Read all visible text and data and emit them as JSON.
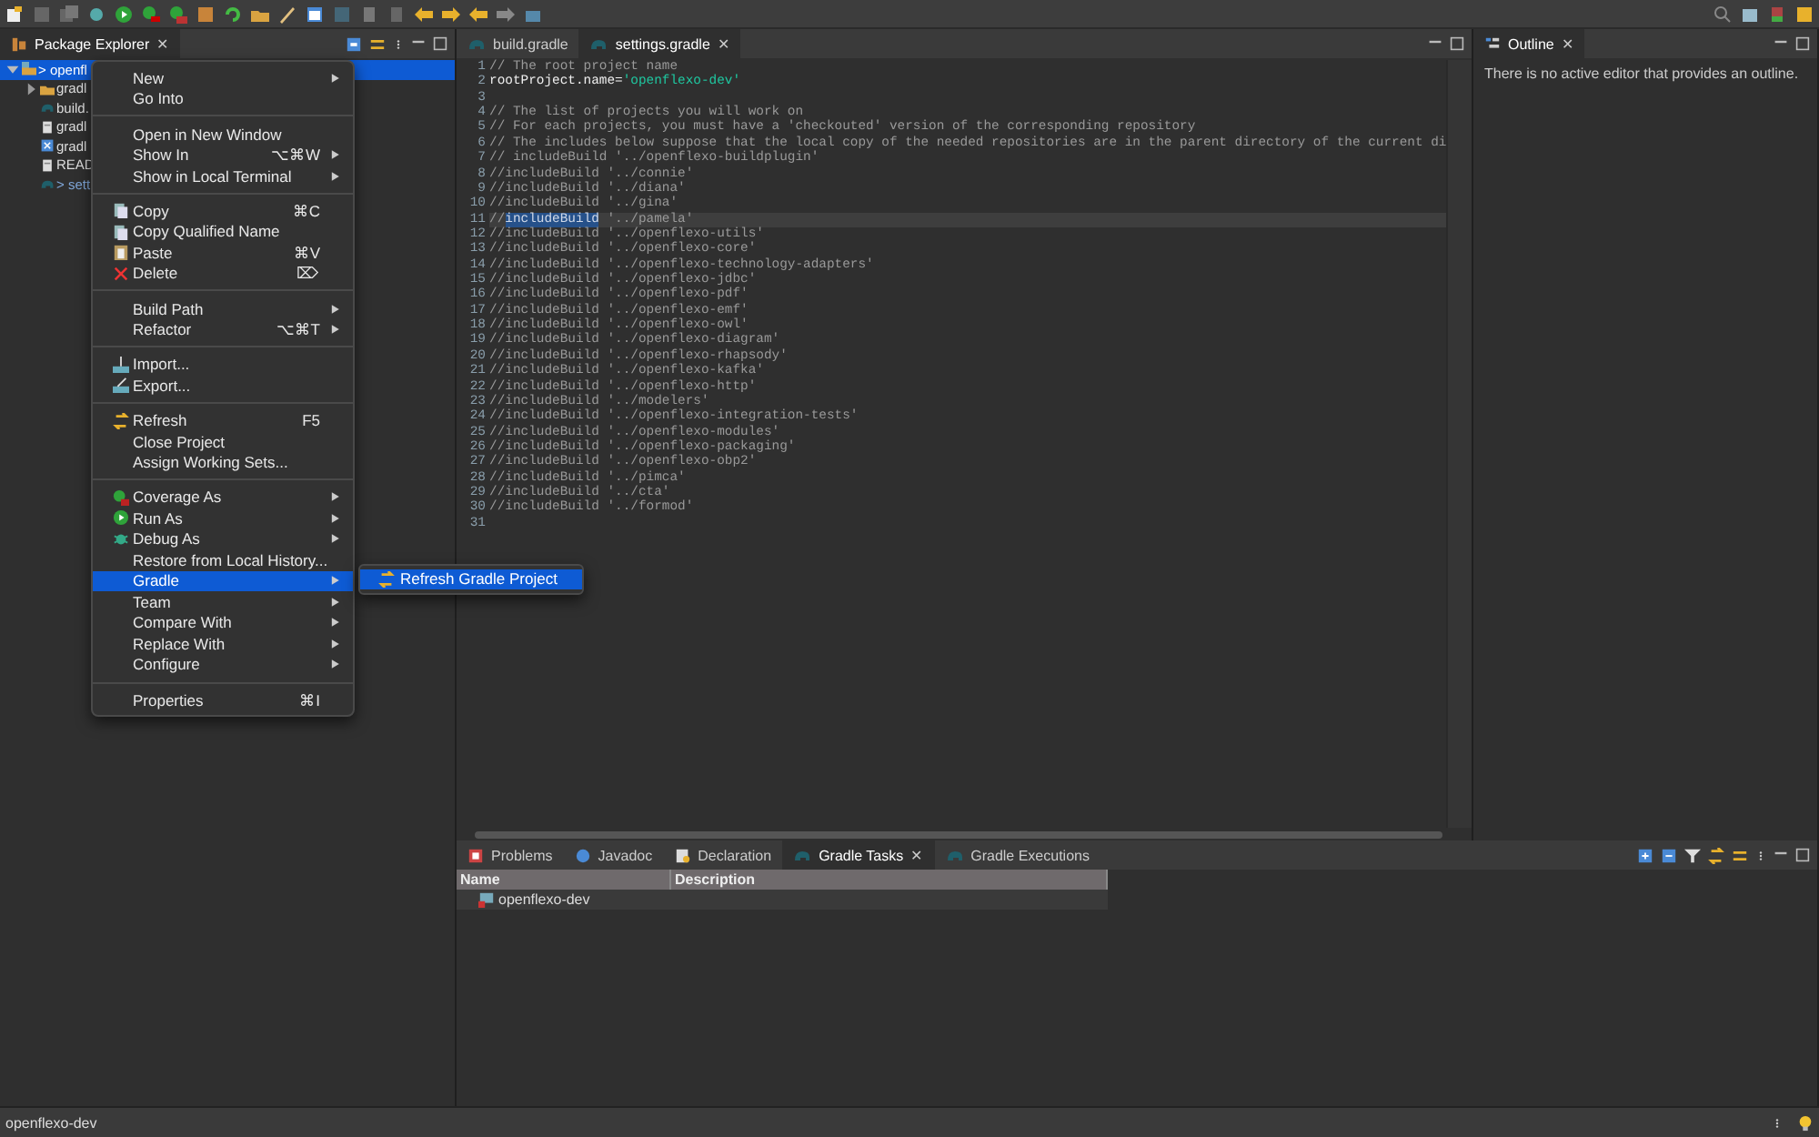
{
  "package_explorer": {
    "tab": {
      "label": "Package Explorer",
      "selected": true,
      "close": "✕"
    },
    "tree": [
      {
        "label": "> openfl",
        "kind": "project",
        "selected": true,
        "expanded": true,
        "modified": false,
        "children": [
          {
            "label": "gradl",
            "kind": "folder",
            "selected": false,
            "expanded": false,
            "modified": false
          },
          {
            "label": "build.",
            "kind": "gradle",
            "selected": false,
            "modified": false
          },
          {
            "label": "gradl",
            "kind": "file",
            "selected": false,
            "modified": false
          },
          {
            "label": "gradl",
            "kind": "script",
            "selected": false,
            "modified": false
          },
          {
            "label": "READ",
            "kind": "file",
            "selected": false,
            "modified": false
          },
          {
            "label": "> sett",
            "kind": "gradle",
            "selected": false,
            "modified": true
          }
        ]
      }
    ]
  },
  "context_menu": {
    "items": [
      {
        "kind": "item",
        "label": "New",
        "submenu": true,
        "selected": false,
        "icon": false
      },
      {
        "kind": "item",
        "label": "Go Into",
        "submenu": false,
        "selected": false,
        "icon": false
      },
      {
        "kind": "separator"
      },
      {
        "kind": "item",
        "label": "Open in New Window",
        "submenu": false,
        "selected": false,
        "icon": false
      },
      {
        "kind": "item",
        "label": "Show In",
        "shortcut": "⌥⌘W",
        "submenu": true,
        "selected": false,
        "icon": false
      },
      {
        "kind": "item",
        "label": "Show in Local Terminal",
        "submenu": true,
        "selected": false,
        "icon": false
      },
      {
        "kind": "separator"
      },
      {
        "kind": "item",
        "label": "Copy",
        "shortcut": "⌘C",
        "submenu": false,
        "selected": false,
        "icon": true
      },
      {
        "kind": "item",
        "label": "Copy Qualified Name",
        "submenu": false,
        "selected": false,
        "icon": true
      },
      {
        "kind": "item",
        "label": "Paste",
        "shortcut": "⌘V",
        "submenu": false,
        "selected": false,
        "icon": true
      },
      {
        "kind": "item",
        "label": "Delete",
        "shortcut": "⌦",
        "submenu": false,
        "selected": false,
        "icon": true
      },
      {
        "kind": "separator"
      },
      {
        "kind": "item",
        "label": "Build Path",
        "submenu": true,
        "selected": false,
        "icon": false
      },
      {
        "kind": "item",
        "label": "Refactor",
        "shortcut": "⌥⌘T",
        "submenu": true,
        "selected": false,
        "icon": false
      },
      {
        "kind": "separator"
      },
      {
        "kind": "item",
        "label": "Import...",
        "submenu": false,
        "selected": false,
        "icon": true
      },
      {
        "kind": "item",
        "label": "Export...",
        "submenu": false,
        "selected": false,
        "icon": true
      },
      {
        "kind": "separator"
      },
      {
        "kind": "item",
        "label": "Refresh",
        "shortcut": "F5",
        "submenu": false,
        "selected": false,
        "icon": true
      },
      {
        "kind": "item",
        "label": "Close Project",
        "submenu": false,
        "selected": false,
        "icon": false
      },
      {
        "kind": "item",
        "label": "Assign Working Sets...",
        "submenu": false,
        "selected": false,
        "icon": false
      },
      {
        "kind": "separator"
      },
      {
        "kind": "item",
        "label": "Coverage As",
        "submenu": true,
        "selected": false,
        "icon": true
      },
      {
        "kind": "item",
        "label": "Run As",
        "submenu": true,
        "selected": false,
        "icon": true
      },
      {
        "kind": "item",
        "label": "Debug As",
        "submenu": true,
        "selected": false,
        "icon": true
      },
      {
        "kind": "item",
        "label": "Restore from Local History...",
        "submenu": false,
        "selected": false,
        "icon": false
      },
      {
        "kind": "item",
        "label": "Gradle",
        "submenu": true,
        "selected": true,
        "icon": false,
        "open_submenu": {
          "items": [
            {
              "label": "Refresh Gradle Project",
              "selected": true,
              "icon": true
            }
          ]
        }
      },
      {
        "kind": "item",
        "label": "Team",
        "submenu": true,
        "selected": false,
        "icon": false
      },
      {
        "kind": "item",
        "label": "Compare With",
        "submenu": true,
        "selected": false,
        "icon": false
      },
      {
        "kind": "item",
        "label": "Replace With",
        "submenu": true,
        "selected": false,
        "icon": false
      },
      {
        "kind": "item",
        "label": "Configure",
        "submenu": true,
        "selected": false,
        "icon": false
      },
      {
        "kind": "separator"
      },
      {
        "kind": "item",
        "label": "Properties",
        "shortcut": "⌘I",
        "submenu": false,
        "selected": false,
        "icon": false
      }
    ]
  },
  "editor": {
    "tabs": [
      {
        "label": "build.gradle",
        "selected": false
      },
      {
        "label": "settings.gradle",
        "selected": true,
        "close": "✕"
      }
    ],
    "lines": [
      {
        "number": "1",
        "current": false,
        "segments": [
          {
            "kind": "comment",
            "text": "// The root project name"
          }
        ]
      },
      {
        "number": "2",
        "current": false,
        "segments": [
          {
            "kind": "code",
            "text": "rootProject.name="
          },
          {
            "kind": "string",
            "text": "'openflexo-dev'"
          }
        ]
      },
      {
        "number": "3",
        "current": false
      },
      {
        "number": "4",
        "current": false,
        "segments": [
          {
            "kind": "comment",
            "text": "// The list of projects you will work on"
          }
        ]
      },
      {
        "number": "5",
        "current": false,
        "segments": [
          {
            "kind": "comment",
            "text": "// For each projects, you must have a 'checkouted' version of the corresponding repository"
          }
        ]
      },
      {
        "number": "6",
        "current": false,
        "segments": [
          {
            "kind": "comment",
            "text": "// The includes below suppose that the local copy of the needed repositories are in the parent directory of the current di"
          }
        ]
      },
      {
        "number": "7",
        "current": false,
        "segments": [
          {
            "kind": "comment",
            "text": "// includeBuild '../openflexo-buildplugin'"
          }
        ]
      },
      {
        "number": "8",
        "current": false,
        "segments": [
          {
            "kind": "comment",
            "text": "//includeBuild '../connie'"
          }
        ]
      },
      {
        "number": "9",
        "current": false,
        "segments": [
          {
            "kind": "comment",
            "text": "//includeBuild '../diana'"
          }
        ]
      },
      {
        "number": "10",
        "current": false,
        "segments": [
          {
            "kind": "comment",
            "text": "//includeBuild '../gina'"
          }
        ]
      },
      {
        "number": "11",
        "current": true,
        "segments": [
          {
            "kind": "comment",
            "text": "//"
          },
          {
            "kind": "selection",
            "text": "includeBuild"
          },
          {
            "kind": "comment",
            "text": " '../pamela'"
          }
        ]
      },
      {
        "number": "12",
        "current": false,
        "segments": [
          {
            "kind": "comment",
            "text": "//includeBuild '../openflexo-utils'"
          }
        ]
      },
      {
        "number": "13",
        "current": false,
        "segments": [
          {
            "kind": "comment",
            "text": "//includeBuild '../openflexo-core'"
          }
        ]
      },
      {
        "number": "14",
        "current": false,
        "segments": [
          {
            "kind": "comment",
            "text": "//includeBuild '../openflexo-technology-adapters'"
          }
        ]
      },
      {
        "number": "15",
        "current": false,
        "segments": [
          {
            "kind": "comment",
            "text": "//includeBuild '../openflexo-jdbc'"
          }
        ]
      },
      {
        "number": "16",
        "current": false,
        "segments": [
          {
            "kind": "comment",
            "text": "//includeBuild '../openflexo-pdf'"
          }
        ]
      },
      {
        "number": "17",
        "current": false,
        "segments": [
          {
            "kind": "comment",
            "text": "//includeBuild '../openflexo-emf'"
          }
        ]
      },
      {
        "number": "18",
        "current": false,
        "segments": [
          {
            "kind": "comment",
            "text": "//includeBuild '../openflexo-owl'"
          }
        ]
      },
      {
        "number": "19",
        "current": false,
        "segments": [
          {
            "kind": "comment",
            "text": "//includeBuild '../openflexo-diagram'"
          }
        ]
      },
      {
        "number": "20",
        "current": false,
        "segments": [
          {
            "kind": "comment",
            "text": "//includeBuild '../openflexo-rhapsody'"
          }
        ]
      },
      {
        "number": "21",
        "current": false,
        "segments": [
          {
            "kind": "comment",
            "text": "//includeBuild '../openflexo-kafka'"
          }
        ]
      },
      {
        "number": "22",
        "current": false,
        "segments": [
          {
            "kind": "comment",
            "text": "//includeBuild '../openflexo-http'"
          }
        ]
      },
      {
        "number": "23",
        "current": false,
        "segments": [
          {
            "kind": "comment",
            "text": "//includeBuild '../modelers'"
          }
        ]
      },
      {
        "number": "24",
        "current": false,
        "segments": [
          {
            "kind": "comment",
            "text": "//includeBuild '../openflexo-integration-tests'"
          }
        ]
      },
      {
        "number": "25",
        "current": false,
        "segments": [
          {
            "kind": "comment",
            "text": "//includeBuild '../openflexo-modules'"
          }
        ]
      },
      {
        "number": "26",
        "current": false,
        "segments": [
          {
            "kind": "comment",
            "text": "//includeBuild '../openflexo-packaging'"
          }
        ]
      },
      {
        "number": "27",
        "current": false,
        "segments": [
          {
            "kind": "comment",
            "text": "//includeBuild '../openflexo-obp2'"
          }
        ]
      },
      {
        "number": "28",
        "current": false,
        "segments": [
          {
            "kind": "comment",
            "text": "//includeBuild '../pimca'"
          }
        ]
      },
      {
        "number": "29",
        "current": false,
        "segments": [
          {
            "kind": "comment",
            "text": "//includeBuild '../cta'"
          }
        ]
      },
      {
        "number": "30",
        "current": false,
        "segments": [
          {
            "kind": "comment",
            "text": "//includeBuild '../formod'"
          }
        ]
      },
      {
        "number": "31",
        "current": false
      }
    ]
  },
  "outline": {
    "tab": {
      "label": "Outline",
      "selected": true,
      "close": "✕"
    },
    "message": "There is no active editor that provides an outline."
  },
  "bottom_panel": {
    "tabs": [
      {
        "label": "Problems",
        "selected": false
      },
      {
        "label": "Javadoc",
        "selected": false
      },
      {
        "label": "Declaration",
        "selected": false
      },
      {
        "label": "Gradle Tasks",
        "selected": true,
        "close": "✕"
      },
      {
        "label": "Gradle Executions",
        "selected": false
      }
    ],
    "table": {
      "columns": [
        "Name",
        "Description"
      ],
      "rows": [
        {
          "name": "openflexo-dev"
        }
      ]
    }
  },
  "status_bar": {
    "text": "openflexo-dev"
  }
}
